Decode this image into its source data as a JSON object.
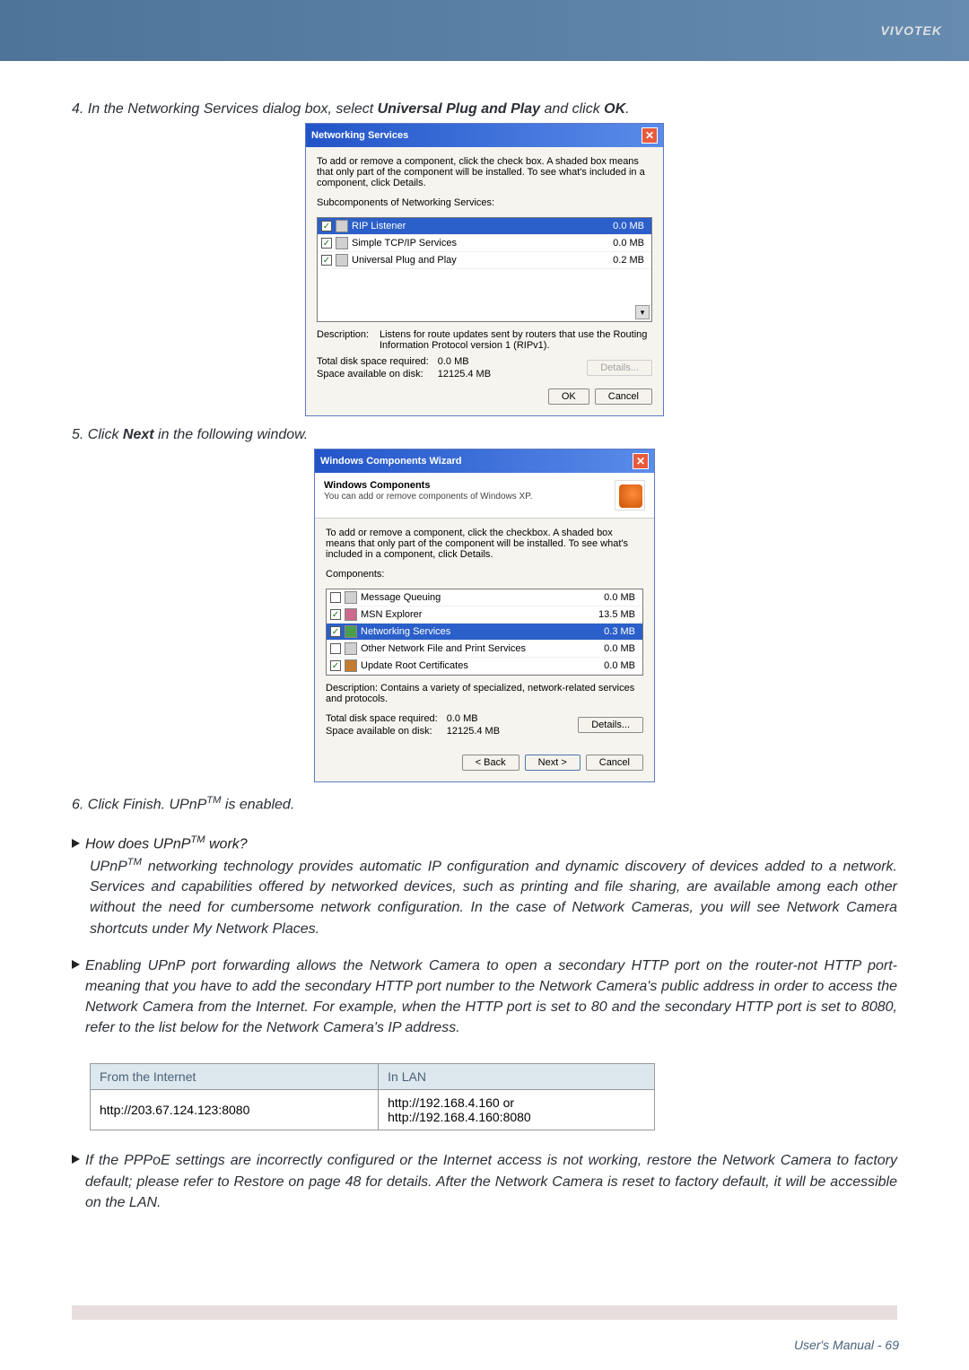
{
  "header": {
    "brand": "VIVOTEK"
  },
  "step4": {
    "prefix": "4. In the Networking Services dialog box, select ",
    "bold1": "Universal Plug and Play",
    "mid": " and click ",
    "bold2": "OK",
    "suffix": "."
  },
  "dialog1": {
    "title": "Networking Services",
    "intro": "To add or remove a component, click the check box. A shaded box means that only part of the component will be installed. To see what's included in a component, click Details.",
    "sub_label": "Subcomponents of Networking Services:",
    "items": [
      {
        "name": "RIP Listener",
        "size": "0.0 MB",
        "selected": true,
        "checked": true
      },
      {
        "name": "Simple TCP/IP Services",
        "size": "0.0 MB",
        "selected": false,
        "checked": true
      },
      {
        "name": "Universal Plug and Play",
        "size": "0.2 MB",
        "selected": false,
        "checked": true
      }
    ],
    "desc_label": "Description:",
    "desc_value": "Listens for route updates sent by routers that use the Routing Information Protocol version 1 (RIPv1).",
    "total_label": "Total disk space required:",
    "total_value": "0.0 MB",
    "avail_label": "Space available on disk:",
    "avail_value": "12125.4 MB",
    "details_btn": "Details...",
    "ok_btn": "OK",
    "cancel_btn": "Cancel"
  },
  "step5": {
    "prefix": "5. Click ",
    "bold": "Next",
    "suffix": " in the following window."
  },
  "dialog2": {
    "title": "Windows Components Wizard",
    "sub_title": "Windows Components",
    "sub_desc": "You can add or remove components of Windows XP.",
    "intro": "To add or remove a component, click the checkbox. A shaded box means that only part of the component will be installed. To see what's included in a component, click Details.",
    "comp_label": "Components:",
    "items": [
      {
        "name": "Message Queuing",
        "size": "0.0 MB",
        "checked": false,
        "selected": false,
        "icon": "plain"
      },
      {
        "name": "MSN Explorer",
        "size": "13.5 MB",
        "checked": true,
        "selected": false,
        "icon": "msn"
      },
      {
        "name": "Networking Services",
        "size": "0.3 MB",
        "checked": true,
        "selected": true,
        "icon": "net"
      },
      {
        "name": "Other Network File and Print Services",
        "size": "0.0 MB",
        "checked": false,
        "selected": false,
        "icon": "plain"
      },
      {
        "name": "Update Root Certificates",
        "size": "0.0 MB",
        "checked": true,
        "selected": false,
        "icon": "cert"
      }
    ],
    "desc_label": "Description:",
    "desc_value": "Contains a variety of specialized, network-related services and protocols.",
    "total_label": "Total disk space required:",
    "total_value": "0.0 MB",
    "avail_label": "Space available on disk:",
    "avail_value": "12125.4 MB",
    "details_btn": "Details...",
    "back_btn": "< Back",
    "next_btn": "Next >",
    "cancel_btn": "Cancel"
  },
  "step6": {
    "prefix": "6. Click ",
    "bold": "Finish",
    "mid": ". UPnP",
    "sup": "TM",
    "suffix": " is enabled."
  },
  "q1": {
    "prefix": "How does UPnP",
    "sup": "TM",
    "suffix": " work?"
  },
  "para1": {
    "p1a": "UPnP",
    "sup": "TM",
    "p1b": " networking technology provides automatic IP configuration and dynamic discovery of devices added to a network. Services and capabilities offered by networked devices, such as printing and file sharing, are available among each other without the need for cumbersome network configuration. In the case of Network Cameras, you will see Network Camera shortcuts under My Network Places."
  },
  "para2": "Enabling UPnP port forwarding allows the Network Camera to open a secondary HTTP port on the router-not HTTP port-meaning that you have to add the secondary HTTP port number to the Network Camera's public address in order to access the Network Camera from the Internet. For example, when the HTTP port is set to 80 and the secondary HTTP port is set to 8080, refer to the list below for the Network Camera's IP address.",
  "table": {
    "h1": "From the Internet",
    "h2": "In LAN",
    "c1": "http://203.67.124.123:8080",
    "c2a": "http://192.168.4.160 or",
    "c2b": "http://192.168.4.160:8080"
  },
  "para3": "If the PPPoE settings are incorrectly configured or the Internet access is not working, restore the Network Camera to factory default; please refer to Restore on page 48 for details. After the Network Camera is reset to factory default, it will be accessible on the LAN.",
  "footer": "User's Manual - 69"
}
